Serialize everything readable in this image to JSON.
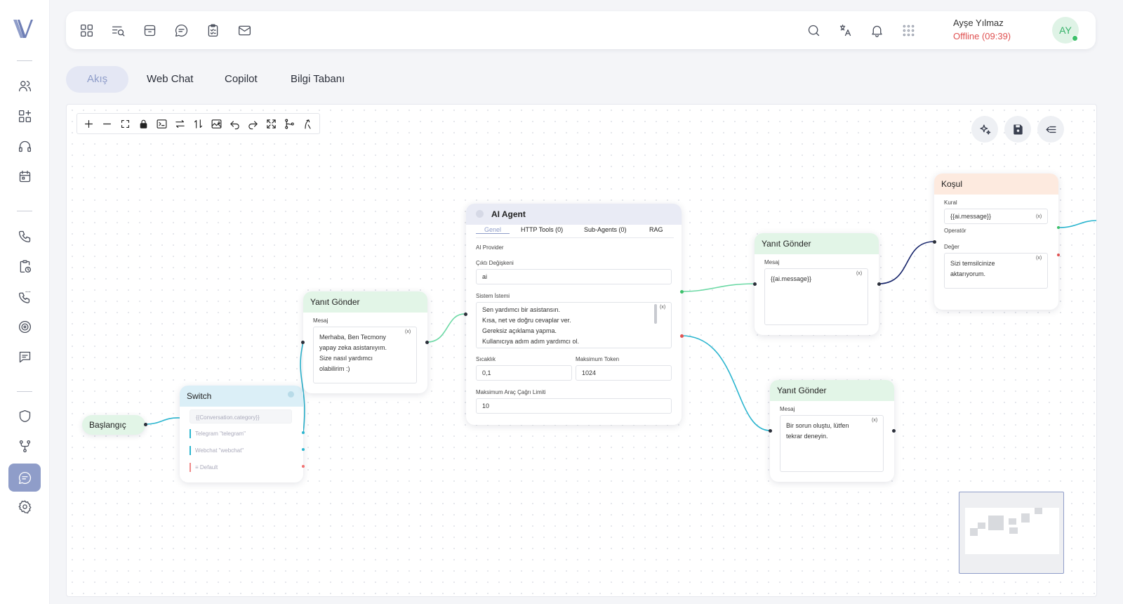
{
  "user": {
    "name": "Ayşe Yılmaz",
    "status": "Offline (09:39)",
    "initials": "AY"
  },
  "tabs": [
    {
      "label": "Akış",
      "active": true
    },
    {
      "label": "Web Chat"
    },
    {
      "label": "Copilot"
    },
    {
      "label": "Bilgi Tabanı"
    }
  ],
  "flow": {
    "start": {
      "label": "Başlangıç"
    },
    "switch_node": {
      "title": "Switch",
      "expression": "{{Conversation.category}}",
      "cases": [
        "Telegram \"telegram\"",
        "Webchat \"webchat\"",
        "≡ Default"
      ]
    },
    "reply1": {
      "title": "Yanıt Gönder",
      "message_label": "Mesaj",
      "message": "Merhaba, Ben Tecmony\nyapay zeka asistanıyım.\nSize nasıl yardımcı\nolabilirim :)"
    },
    "ai_agent": {
      "title": "AI Agent",
      "tabs": [
        "Genel",
        "HTTP Tools (0)",
        "Sub-Agents (0)",
        "RAG"
      ],
      "provider_label": "AI Provider",
      "output_label": "Çıktı Değişkeni",
      "output_value": "ai",
      "system_label": "Sistem İstemi",
      "system_prompt": "Sen yardımcı bir asistansın.\nKısa, net ve doğru cevaplar ver.\nGereksiz açıklama yapma.\nKullanıcıya adım adım yardımcı ol.",
      "temp_label": "Sıcaklık",
      "temp_value": "0,1",
      "max_token_label": "Maksimum Token",
      "max_token_value": "1024",
      "max_tool_label": "Maksimum Araç Çağrı Limiti",
      "max_tool_value": "10"
    },
    "reply2": {
      "title": "Yanıt Gönder",
      "message_label": "Mesaj",
      "message": "{{ai.message}}"
    },
    "reply3": {
      "title": "Yanıt Gönder",
      "message_label": "Mesaj",
      "message": "Bir sorun oluştu, lütfen\ntekrar deneyin."
    },
    "condition": {
      "title": "Koşul",
      "rule_label": "Kural",
      "rule_value": "{{ai.message}}",
      "operator_label": "Operatör",
      "value_label": "Değer",
      "value": "Sizi temsilcinize\naktarıyorum."
    },
    "var_marker": "(x)"
  },
  "colors": {
    "accent": "#8f9dc9",
    "offline": "#e05252",
    "online": "#3cc06a",
    "edge_green": "#6cd9a5",
    "edge_teal": "#2bb5cf",
    "edge_navy": "#16246a"
  }
}
